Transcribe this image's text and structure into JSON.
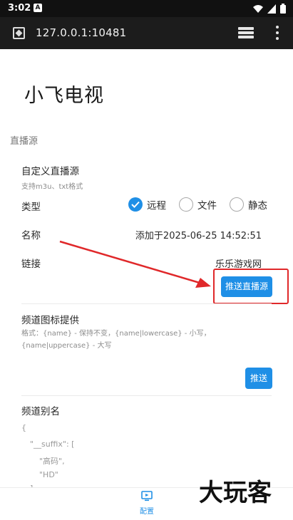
{
  "status_bar": {
    "time": "3:02",
    "notification_badge": "A"
  },
  "browser": {
    "url": "127.0.0.1:10481"
  },
  "page": {
    "title": "小飞电视",
    "section_title": "直播源",
    "custom_source": {
      "title": "自定义直播源",
      "subtitle": "支持m3u、txt格式",
      "type_label": "类型",
      "type_options": [
        {
          "label": "远程",
          "checked": true
        },
        {
          "label": "文件",
          "checked": false
        },
        {
          "label": "静态",
          "checked": false
        }
      ],
      "name_label": "名称",
      "name_value": "添加于2025-06-25 14:52:51",
      "link_label": "链接",
      "link_value": "乐乐游戏网",
      "push_button": "推送直播源"
    },
    "channel_logo": {
      "title": "频道图标提供",
      "hint": "格式：{name} - 保持不变，{name|lowercase} - 小写，{name|uppercase} - 大写",
      "push_button": "推送"
    },
    "channel_alias": {
      "title": "频道别名",
      "code_lines": [
        "{",
        "\"__suffix\": [",
        "\"高码\",",
        "\"HD\"",
        "],"
      ]
    }
  },
  "bottom_nav": {
    "label": "配置"
  },
  "watermark": {
    "text": "大玩客"
  },
  "colors": {
    "accent": "#1f8fe6",
    "highlight": "#e0282a",
    "toolbar": "#1c1c1c"
  },
  "icons": [
    "site-icon",
    "tabs-icon",
    "menu-icon",
    "wifi-icon",
    "signal-icon",
    "battery-icon",
    "config-icon",
    "check-icon"
  ]
}
